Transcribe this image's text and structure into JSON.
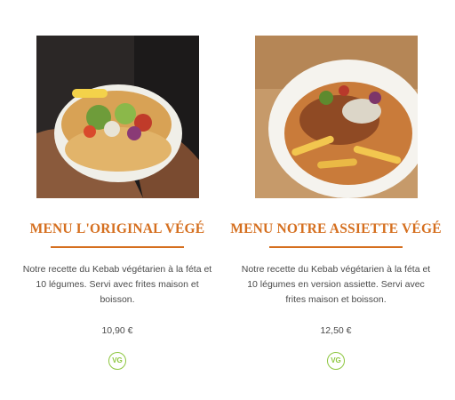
{
  "products": [
    {
      "photo_icon": "kebab-sandwich-photo",
      "title": "MENU L'ORIGINAL VÉGÉ",
      "description": "Notre recette du Kebab végétarien à la féta et 10 légumes. Servi avec frites maison et boisson.",
      "price": "10,90 €",
      "badge": "VG"
    },
    {
      "photo_icon": "kebab-plate-photo",
      "title": "MENU NOTRE ASSIETTE VÉGÉ",
      "description": "Notre recette du Kebab végétarien à la féta et 10 légumes en version assiette. Servi avec frites maison et boisson.",
      "price": "12,50 €",
      "badge": "VG"
    }
  ],
  "colors": {
    "title": "#d56f1f",
    "badge": "#8dc63f",
    "text": "#4a4a4a"
  }
}
